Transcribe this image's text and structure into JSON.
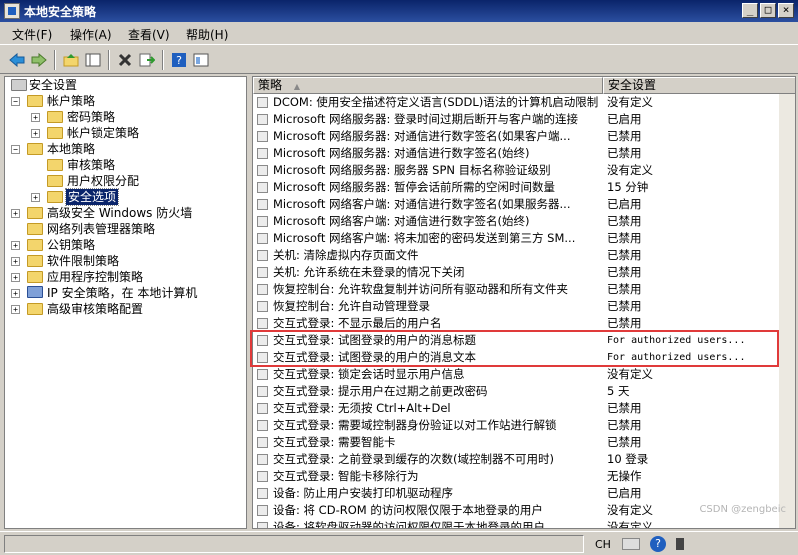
{
  "window": {
    "title": "本地安全策略"
  },
  "window_controls": {
    "minimize": "_",
    "maximize": "□",
    "close": "×"
  },
  "menu": [
    "文件(F)",
    "操作(A)",
    "查看(V)",
    "帮助(H)"
  ],
  "toolbar": [
    "back-icon",
    "forward-icon",
    "up-icon",
    "show-tree-icon",
    "delete-icon",
    "export-icon",
    "help-icon",
    "properties-icon"
  ],
  "tree": [
    {
      "label": "安全设置",
      "expander": ""
    },
    {
      "label": "帐户策略",
      "expander": "−"
    },
    {
      "label": "密码策略",
      "expander": "+"
    },
    {
      "label": "帐户锁定策略",
      "expander": "+"
    },
    {
      "label": "本地策略",
      "expander": "−"
    },
    {
      "label": "审核策略",
      "expander": ""
    },
    {
      "label": "用户权限分配",
      "expander": ""
    },
    {
      "label": "安全选项",
      "expander": "+"
    },
    {
      "label": "高级安全 Windows 防火墙",
      "expander": "+"
    },
    {
      "label": "网络列表管理器策略",
      "expander": ""
    },
    {
      "label": "公钥策略",
      "expander": "+"
    },
    {
      "label": "软件限制策略",
      "expander": "+"
    },
    {
      "label": "应用程序控制策略",
      "expander": "+"
    },
    {
      "label": "IP 安全策略，在 本地计算机",
      "expander": "+"
    },
    {
      "label": "高级审核策略配置",
      "expander": "+"
    }
  ],
  "list": {
    "headers": {
      "policy": "策略",
      "setting": "安全设置",
      "sort_indicator": "▲"
    },
    "rows": [
      {
        "name": "DCOM: 使用安全描述符定义语言(SDDL)语法的计算机启动限制",
        "value": "没有定义"
      },
      {
        "name": "Microsoft 网络服务器: 登录时间过期后断开与客户端的连接",
        "value": "已启用"
      },
      {
        "name": "Microsoft 网络服务器: 对通信进行数字签名(如果客户端...",
        "value": "已禁用"
      },
      {
        "name": "Microsoft 网络服务器: 对通信进行数字签名(始终)",
        "value": "已禁用"
      },
      {
        "name": "Microsoft 网络服务器: 服务器 SPN 目标名称验证级别",
        "value": "没有定义"
      },
      {
        "name": "Microsoft 网络服务器: 暂停会话前所需的空闲时间数量",
        "value": "15 分钟"
      },
      {
        "name": "Microsoft 网络客户端: 对通信进行数字签名(如果服务器...",
        "value": "已启用"
      },
      {
        "name": "Microsoft 网络客户端: 对通信进行数字签名(始终)",
        "value": "已禁用"
      },
      {
        "name": "Microsoft 网络客户端: 将未加密的密码发送到第三方 SM...",
        "value": "已禁用"
      },
      {
        "name": "关机: 清除虚拟内存页面文件",
        "value": "已禁用"
      },
      {
        "name": "关机: 允许系统在未登录的情况下关闭",
        "value": "已禁用"
      },
      {
        "name": "恢复控制台: 允许软盘复制并访问所有驱动器和所有文件夹",
        "value": "已禁用"
      },
      {
        "name": "恢复控制台: 允许自动管理登录",
        "value": "已禁用"
      },
      {
        "name": "交互式登录: 不显示最后的用户名",
        "value": "已禁用"
      },
      {
        "name": "交互式登录: 试图登录的用户的消息标题",
        "value": "For authorized users..."
      },
      {
        "name": "交互式登录: 试图登录的用户的消息文本",
        "value": "For authorized users..."
      },
      {
        "name": "交互式登录: 锁定会话时显示用户信息",
        "value": "没有定义"
      },
      {
        "name": "交互式登录: 提示用户在过期之前更改密码",
        "value": "5 天"
      },
      {
        "name": "交互式登录: 无须按 Ctrl+Alt+Del",
        "value": "已禁用"
      },
      {
        "name": "交互式登录: 需要域控制器身份验证以对工作站进行解锁",
        "value": "已禁用"
      },
      {
        "name": "交互式登录: 需要智能卡",
        "value": "已禁用"
      },
      {
        "name": "交互式登录: 之前登录到缓存的次数(域控制器不可用时)",
        "value": "10 登录"
      },
      {
        "name": "交互式登录: 智能卡移除行为",
        "value": "无操作"
      },
      {
        "name": "设备: 防止用户安装打印机驱动程序",
        "value": "已启用"
      },
      {
        "name": "设备: 将 CD-ROM 的访问权限仅限于本地登录的用户",
        "value": "没有定义"
      },
      {
        "name": "设备: 将软盘驱动器的访问权限仅限于本地登录的用户",
        "value": "没有定义"
      }
    ]
  },
  "statusbar": {
    "lang": "CH"
  },
  "watermark": "CSDN @zengbeic",
  "colors": {
    "title_start": "#0a246a",
    "selection": "#0a246a",
    "highlight_box": "#e03a3a"
  }
}
